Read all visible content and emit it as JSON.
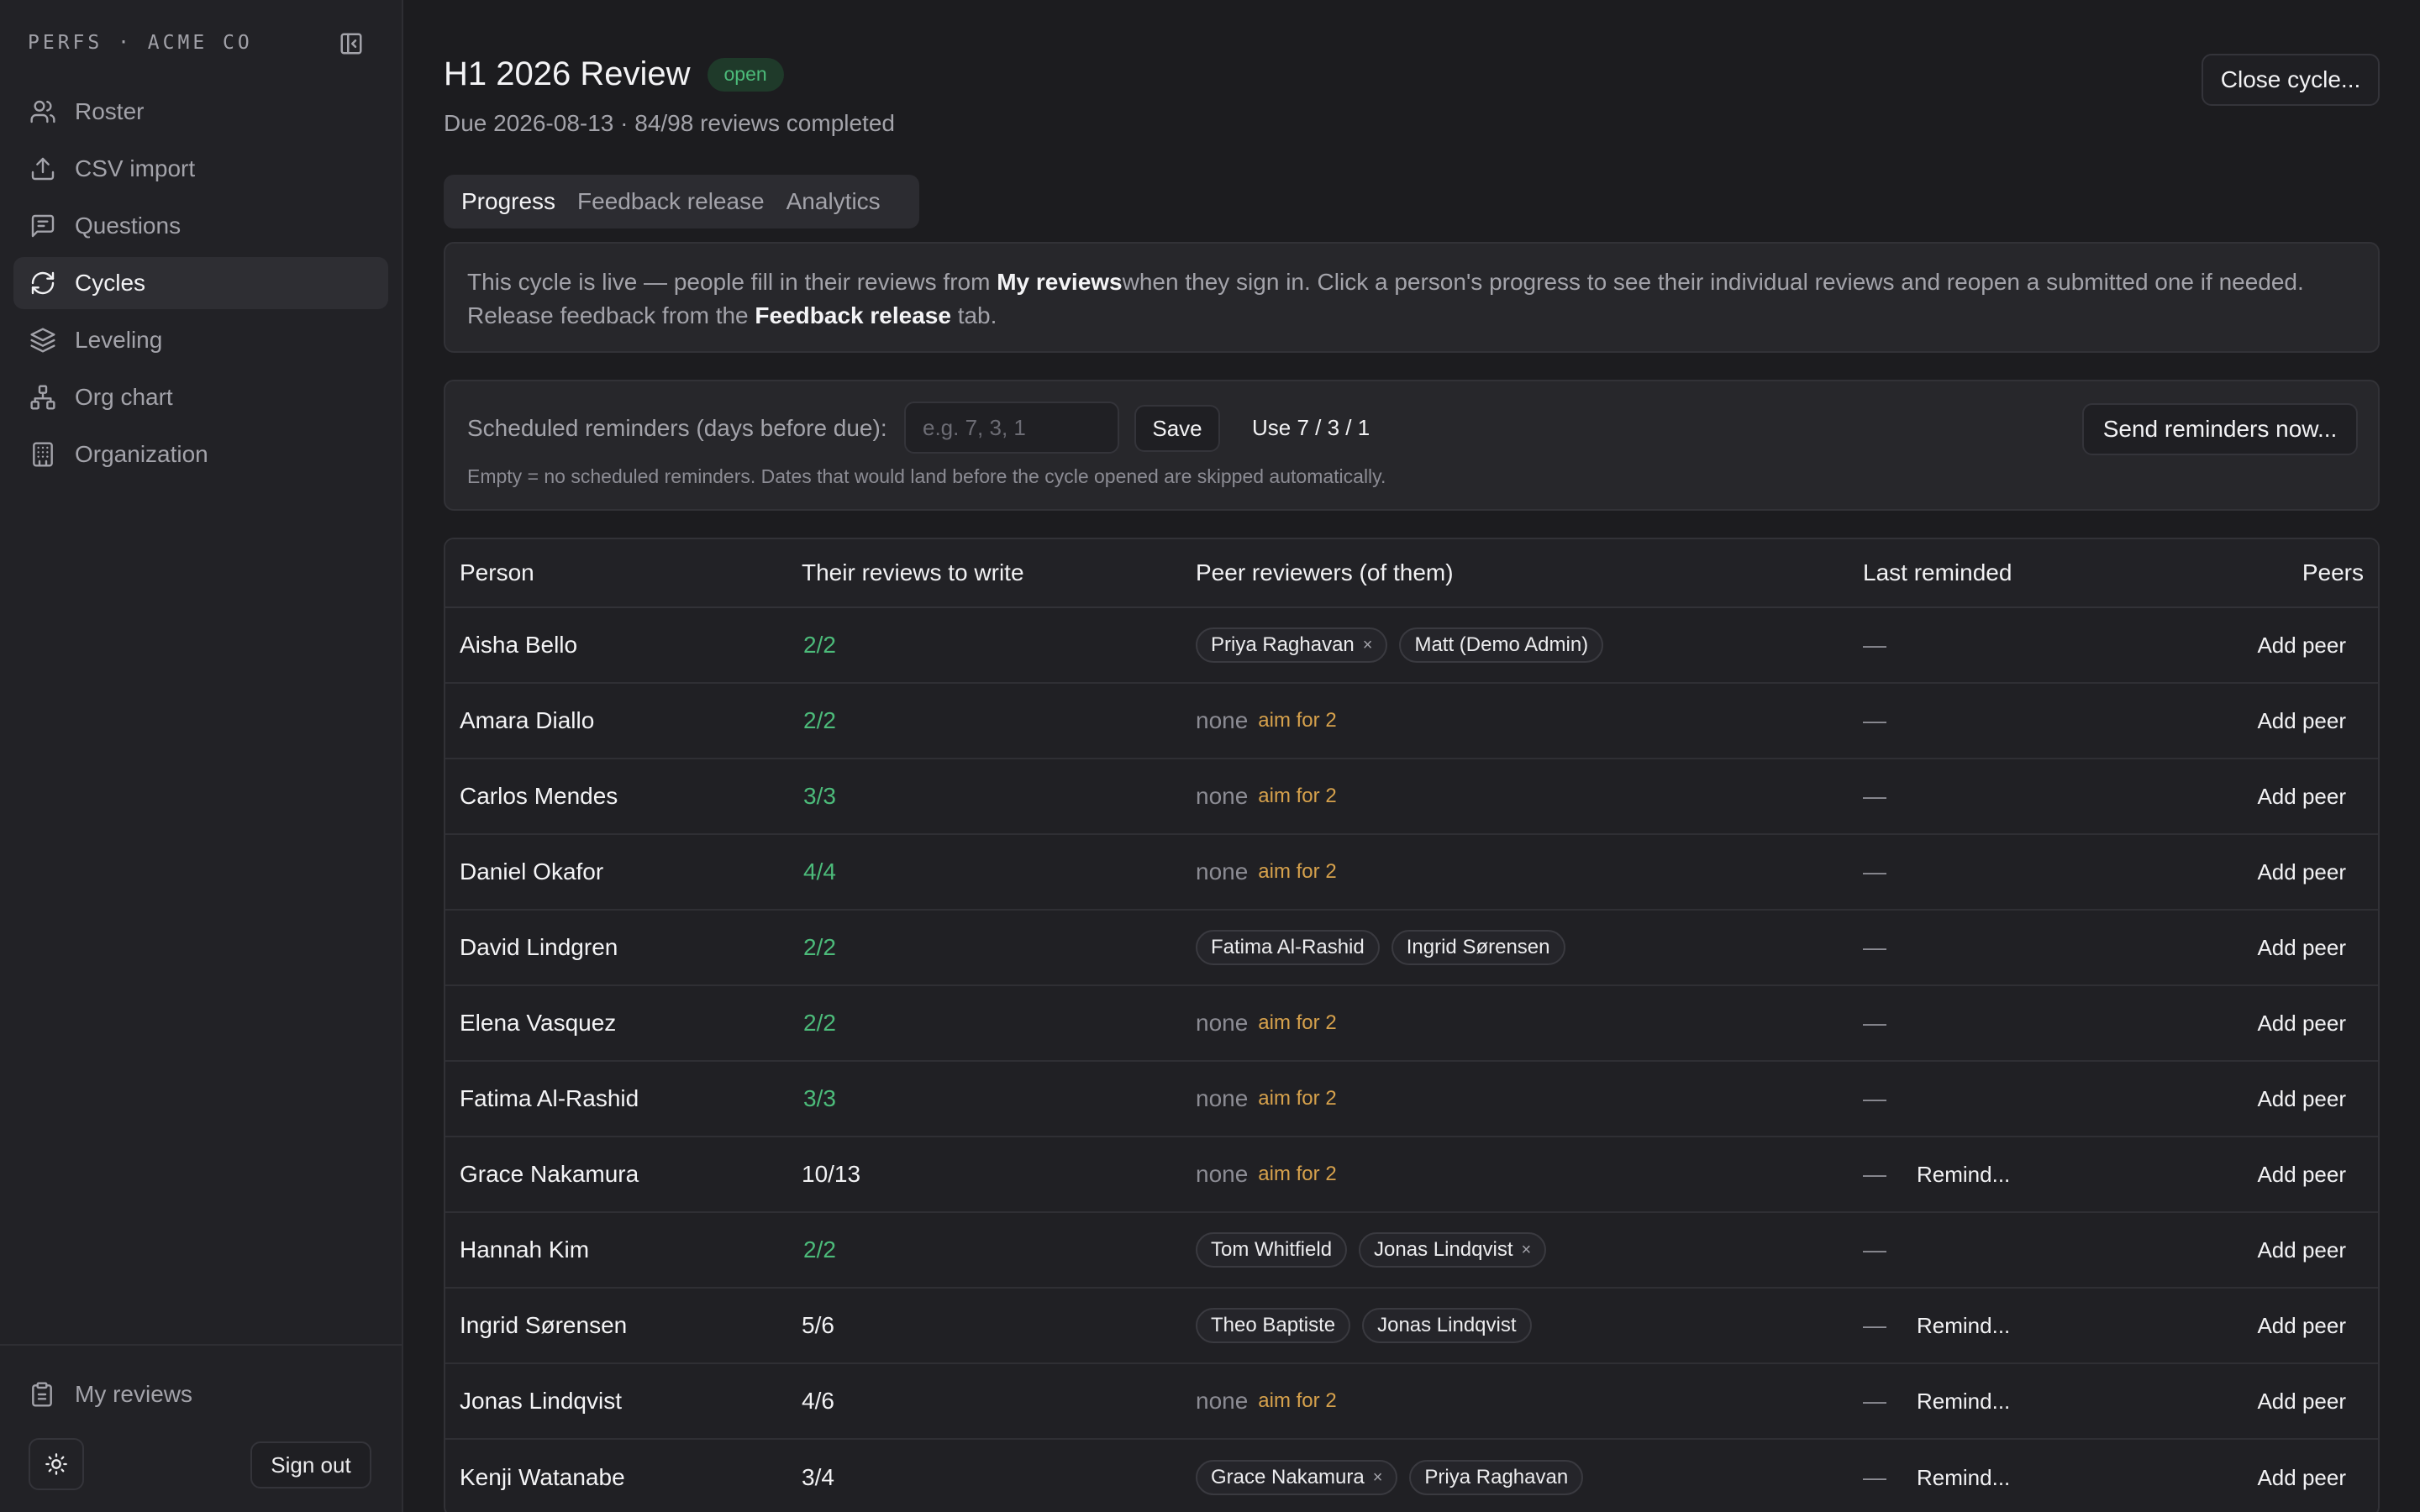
{
  "brand": "PERFS · ACME CO",
  "sidebar": {
    "items": [
      {
        "label": "Roster",
        "icon": "users-icon",
        "active": false
      },
      {
        "label": "CSV import",
        "icon": "upload-icon",
        "active": false
      },
      {
        "label": "Questions",
        "icon": "message-square-icon",
        "active": false
      },
      {
        "label": "Cycles",
        "icon": "refresh-icon",
        "active": true
      },
      {
        "label": "Leveling",
        "icon": "layers-icon",
        "active": false
      },
      {
        "label": "Org chart",
        "icon": "org-chart-icon",
        "active": false
      },
      {
        "label": "Organization",
        "icon": "building-icon",
        "active": false
      }
    ],
    "my_reviews": "My reviews",
    "sign_out": "Sign out"
  },
  "header": {
    "title": "H1 2026 Review",
    "status": "open",
    "subtitle": "Due 2026-08-13 · 84/98 reviews completed",
    "close_cycle": "Close cycle..."
  },
  "tabs": [
    {
      "label": "Progress",
      "active": true
    },
    {
      "label": "Feedback release",
      "active": false
    },
    {
      "label": "Analytics",
      "active": false
    }
  ],
  "info": {
    "part1": "This cycle is live — people fill in their reviews from ",
    "link1": "My reviews",
    "part2": "when they sign in. Click a person's progress to see their individual reviews and reopen a submitted one if needed.",
    "part3": "Release feedback from the ",
    "link2": "Feedback release",
    "part4": " tab."
  },
  "reminders": {
    "label": "Scheduled reminders (days before due):",
    "placeholder": "e.g. 7, 3, 1",
    "save": "Save",
    "preset": "Use 7 / 3 / 1",
    "send_now": "Send reminders now...",
    "help": "Empty = no scheduled reminders. Dates that would land before the cycle opened are skipped automatically."
  },
  "table": {
    "columns": {
      "person": "Person",
      "reviews": "Their reviews to write",
      "peer_reviewers": "Peer reviewers (of them)",
      "last_reminded": "Last reminded",
      "peers": "Peers"
    },
    "none_label": "none",
    "aim_label": "aim for 2",
    "dash": "—",
    "remind_label": "Remind...",
    "add_peer_label": "Add peer",
    "rows": [
      {
        "person": "Aisha Bello",
        "reviews": "2/2",
        "complete": true,
        "peers": [
          {
            "name": "Priya Raghavan",
            "removable": true
          },
          {
            "name": "Matt (Demo Admin)",
            "removable": false
          }
        ],
        "remind": false
      },
      {
        "person": "Amara Diallo",
        "reviews": "2/2",
        "complete": true,
        "peers": [],
        "remind": false
      },
      {
        "person": "Carlos Mendes",
        "reviews": "3/3",
        "complete": true,
        "peers": [],
        "remind": false
      },
      {
        "person": "Daniel Okafor",
        "reviews": "4/4",
        "complete": true,
        "peers": [],
        "remind": false
      },
      {
        "person": "David Lindgren",
        "reviews": "2/2",
        "complete": true,
        "peers": [
          {
            "name": "Fatima Al-Rashid",
            "removable": false
          },
          {
            "name": "Ingrid Sørensen",
            "removable": false
          }
        ],
        "remind": false
      },
      {
        "person": "Elena Vasquez",
        "reviews": "2/2",
        "complete": true,
        "peers": [],
        "remind": false
      },
      {
        "person": "Fatima Al-Rashid",
        "reviews": "3/3",
        "complete": true,
        "peers": [],
        "remind": false
      },
      {
        "person": "Grace Nakamura",
        "reviews": "10/13",
        "complete": false,
        "peers": [],
        "remind": true
      },
      {
        "person": "Hannah Kim",
        "reviews": "2/2",
        "complete": true,
        "peers": [
          {
            "name": "Tom Whitfield",
            "removable": false
          },
          {
            "name": "Jonas Lindqvist",
            "removable": true
          }
        ],
        "remind": false
      },
      {
        "person": "Ingrid Sørensen",
        "reviews": "5/6",
        "complete": false,
        "peers": [
          {
            "name": "Theo Baptiste",
            "removable": false
          },
          {
            "name": "Jonas Lindqvist",
            "removable": false
          }
        ],
        "remind": true
      },
      {
        "person": "Jonas Lindqvist",
        "reviews": "4/6",
        "complete": false,
        "peers": [],
        "remind": true
      },
      {
        "person": "Kenji Watanabe",
        "reviews": "3/4",
        "complete": false,
        "peers": [
          {
            "name": "Grace Nakamura",
            "removable": true
          },
          {
            "name": "Priya Raghavan",
            "removable": false
          }
        ],
        "remind": true
      }
    ]
  },
  "colors": {
    "background": "#1c1c1f",
    "sidebar": "#222226",
    "complete_green": "#4cbb7a",
    "aim_amber": "#d6a14c",
    "status_badge_bg": "#1f3a2a"
  }
}
